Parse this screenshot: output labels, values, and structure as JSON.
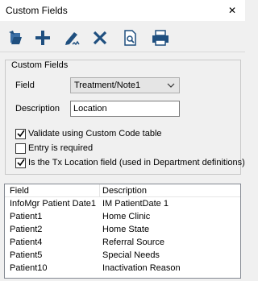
{
  "window": {
    "title": "Custom Fields",
    "close": "✕"
  },
  "toolbar": {
    "items": [
      {
        "name": "open-icon"
      },
      {
        "name": "add-icon"
      },
      {
        "name": "edit-icon"
      },
      {
        "name": "delete-icon"
      },
      {
        "name": "preview-icon"
      },
      {
        "name": "print-icon"
      }
    ]
  },
  "group": {
    "label": "Custom Fields"
  },
  "field": {
    "label": "Field",
    "value": "Treatment/Note1"
  },
  "description": {
    "label": "Description",
    "value": "Location"
  },
  "checks": [
    {
      "label": "Validate using Custom Code table",
      "checked": true
    },
    {
      "label": "Entry is required",
      "checked": false
    },
    {
      "label": "Is the Tx Location field (used in Department definitions)",
      "checked": true
    }
  ],
  "grid": {
    "columns": [
      "Field",
      "Description"
    ],
    "rows": [
      [
        "InfoMgr Patient Date1",
        "IM PatientDate 1"
      ],
      [
        "Patient1",
        "Home Clinic"
      ],
      [
        "Patient2",
        "Home State"
      ],
      [
        "Patient4",
        "Referral Source"
      ],
      [
        "Patient5",
        "Special Needs"
      ],
      [
        "Patient10",
        "Inactivation Reason"
      ]
    ]
  }
}
